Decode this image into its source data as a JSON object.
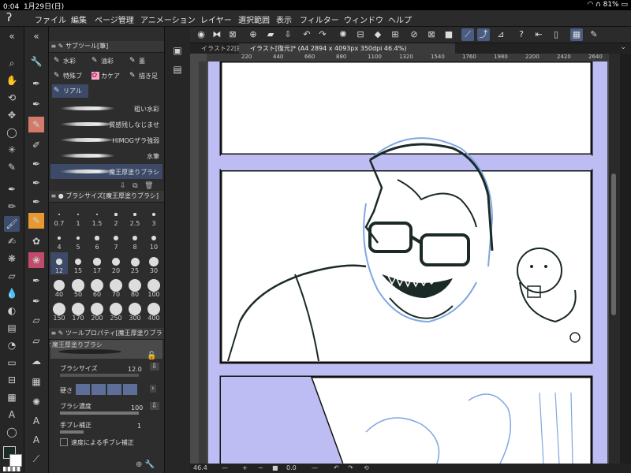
{
  "status": {
    "time": "0:04",
    "date": "1月29日(日)",
    "battery": "81%"
  },
  "menu": [
    "ファイル",
    "編集",
    "ページ管理",
    "アニメーション",
    "レイヤー",
    "選択範囲",
    "表示",
    "フィルター",
    "ウィンドウ",
    "ヘルプ"
  ],
  "subtool_panel": {
    "title": "サブツール[筆]",
    "groups": [
      {
        "label": "水彩",
        "icon": "brush-icon"
      },
      {
        "label": "油彩",
        "icon": "brush-icon"
      },
      {
        "label": "墨",
        "icon": "brush-icon"
      },
      {
        "label": "特殊ブ",
        "icon": "brush-icon"
      },
      {
        "label": "カケア",
        "icon": "brush-icon"
      },
      {
        "label": "描き足",
        "icon": "brush-icon"
      },
      {
        "label": "リアル",
        "icon": "brush-icon"
      }
    ],
    "brushes": [
      {
        "label": "粗い水彩"
      },
      {
        "label": "質感残しなじませ"
      },
      {
        "label": "HIMOGザラ強弱"
      },
      {
        "label": "水筆"
      },
      {
        "label": "魔王厚塗りブラシ"
      }
    ]
  },
  "brush_size_panel": {
    "title": "ブラシサイズ[魔王厚塗りブラシ]",
    "sizes": [
      "0.7",
      "1",
      "1.5",
      "2",
      "2.5",
      "3",
      "4",
      "5",
      "6",
      "7",
      "8",
      "10",
      "12",
      "15",
      "17",
      "20",
      "25",
      "30",
      "40",
      "50",
      "60",
      "70",
      "80",
      "100",
      "150",
      "170",
      "200",
      "250",
      "300",
      "400"
    ]
  },
  "tool_property_panel": {
    "title": "ツールプロパティ[魔王厚塗りブラシ]",
    "preview_label": "魔王厚塗りブラシ",
    "brush_size_label": "ブラシサイズ",
    "brush_size_value": "12.0",
    "hardness_label": "硬さ",
    "density_label": "ブラシ濃度",
    "density_value": "100",
    "stabilization_label": "手ブレ補正",
    "stabilization_value": "1",
    "speed_stab_label": "速度による手ブレ補正"
  },
  "tabs": [
    {
      "label": "イラスト22[抜"
    },
    {
      "label": "イラスト[復元]* (A4 2894 x 4093px 350dpi 46.4%)"
    }
  ],
  "ruler_ticks": [
    "220",
    "440",
    "660",
    "880",
    "1100",
    "1320",
    "1540",
    "1760",
    "1980",
    "2200",
    "2420",
    "2640"
  ],
  "bottom": {
    "zoom": "46.4",
    "angle": "0.0"
  },
  "colors": {
    "accent": "#4a5c82",
    "canvas_bg": "#bdbdf3",
    "pink": "#f7a8c8"
  }
}
